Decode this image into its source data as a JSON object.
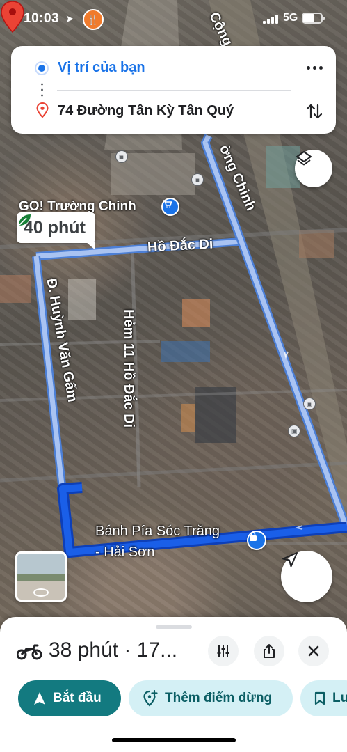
{
  "status_bar": {
    "time": "10:03",
    "network": "5G"
  },
  "directions": {
    "origin": "Vị trí của bạn",
    "destination": "74 Đường Tân Kỳ Tân Quý"
  },
  "map": {
    "route_time_chip": "40 phút",
    "labels": {
      "go_store": "GO! Trường Chinh",
      "ho_dac_di": "Hồ Đắc Di",
      "huynh_van_gam": "Đ. Huỳnh Văn Gấm",
      "hem_11": "Hẻm 11 Hồ Đắc Di",
      "truong_chinh": "ờng Chinh",
      "cong_hoa": "Cộng",
      "banh_pia_line1": "Bánh Pía Sóc Trăng",
      "banh_pia_line2": "- Hải Sơn"
    },
    "route_color": "#1a73e8"
  },
  "sheet": {
    "travel_mode_icon": "motorbike-icon",
    "summary": "38 phút · 17...",
    "start_label": "Bắt đầu",
    "add_stop_label": "Thêm điểm dừng",
    "save_label": "Lưu"
  },
  "colors": {
    "accent_blue": "#1a73e8",
    "start_button": "#137a80",
    "secondary_pill": "#d4f0f5",
    "pin_red": "#ea4335"
  }
}
